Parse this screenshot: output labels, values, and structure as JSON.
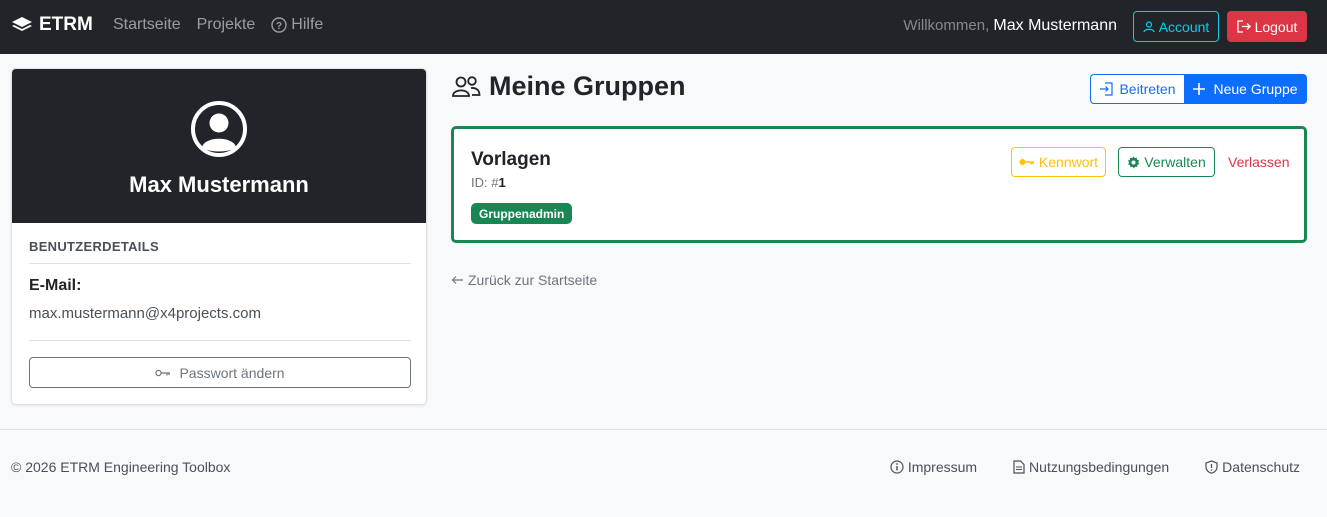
{
  "nav": {
    "brand": "ETRM",
    "links": [
      "Startseite",
      "Projekte",
      "Hilfe"
    ],
    "welcome_prefix": "Willkommen,",
    "user_name": "Max Mustermann",
    "account_label": "Account",
    "logout_label": "Logout"
  },
  "profile": {
    "name": "Max Mustermann",
    "section_title": "BENUTZERDETAILS",
    "email_label": "E-Mail:",
    "email_value": "max.mustermann@x4projects.com",
    "change_password_label": "Passwort ändern"
  },
  "main": {
    "title": "Meine Gruppen",
    "join_label": "Beitreten",
    "new_group_label": "Neue Gruppe",
    "groups": [
      {
        "name": "Vorlagen",
        "id_prefix": "ID: #",
        "id": "1",
        "badge": "Gruppenadmin",
        "password_label": "Kennwort",
        "manage_label": "Verwalten",
        "leave_label": "Verlassen"
      }
    ],
    "back_label": "Zurück zur Startseite"
  },
  "footer": {
    "copyright": "© 2026 ETRM Engineering Toolbox",
    "links": [
      "Impressum",
      "Nutzungsbedingungen",
      "Datenschutz"
    ]
  },
  "colors": {
    "navbar_bg": "#212529",
    "primary": "#0d6efd",
    "success": "#198754",
    "danger": "#dc3545",
    "warning": "#ffc107",
    "info": "#0dcaf0"
  }
}
